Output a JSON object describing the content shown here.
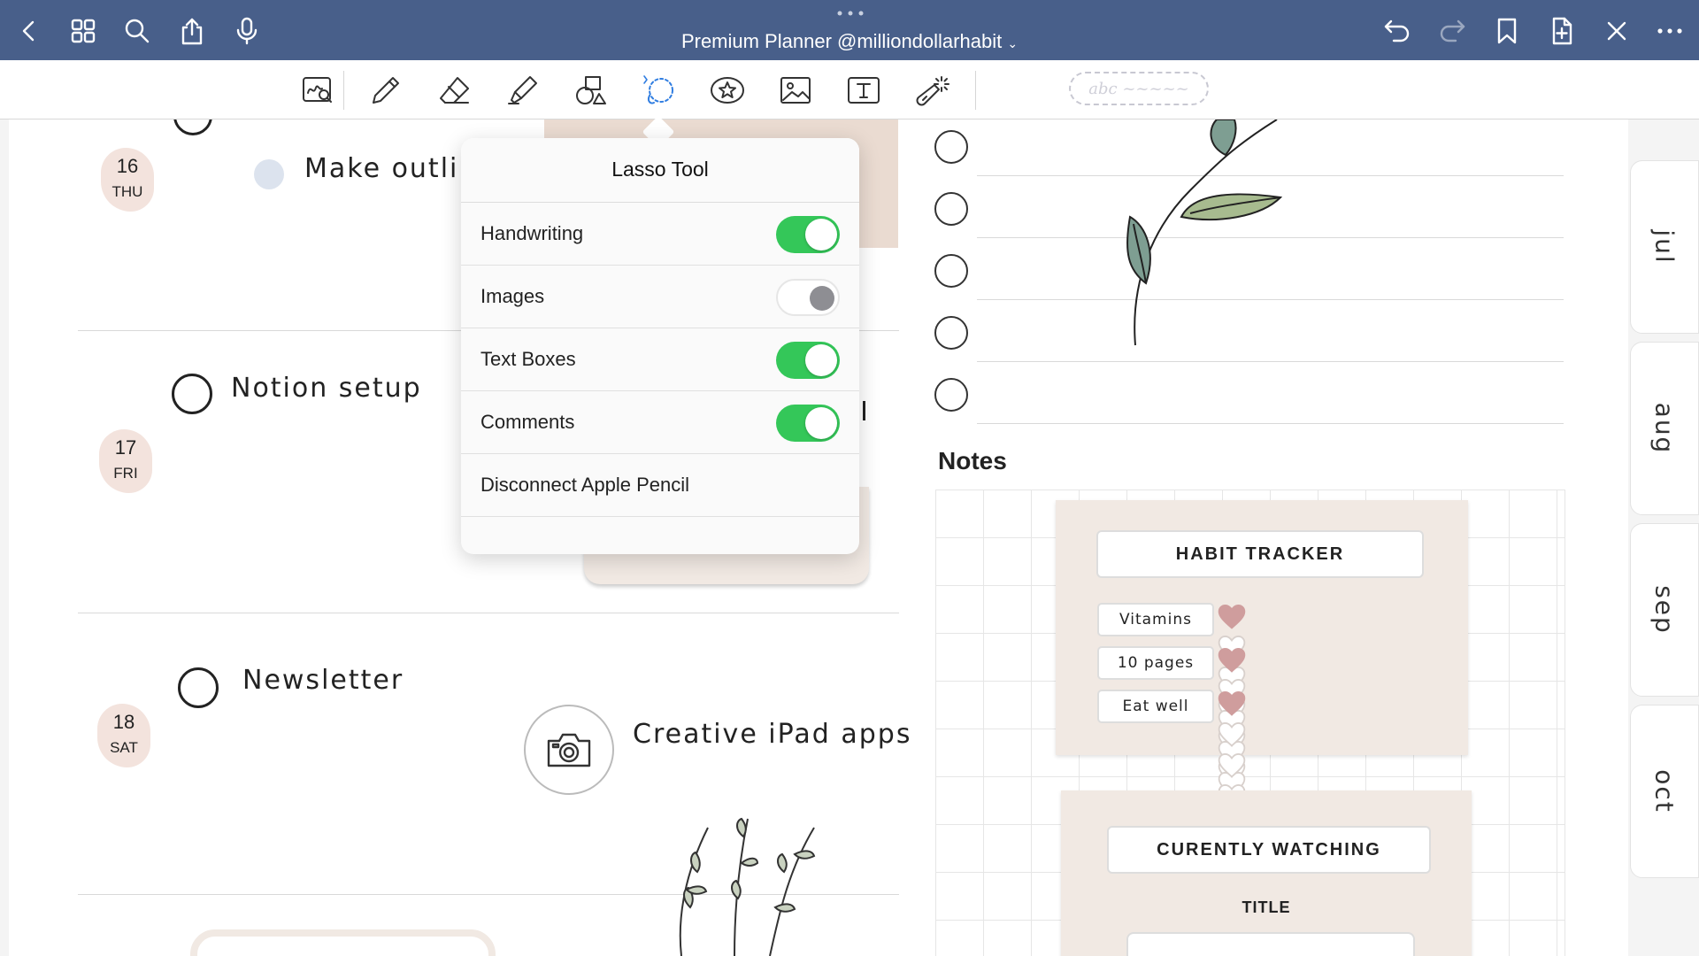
{
  "app": {
    "document_title": "Premium Planner @milliondollarhabit"
  },
  "titlebar": {
    "left_icons": [
      "back-chevron-icon",
      "grid-icon",
      "search-icon",
      "share-icon",
      "microphone-icon"
    ],
    "right_icons": [
      "undo-icon",
      "redo-icon",
      "bookmark-icon",
      "add-page-icon",
      "close-x-icon",
      "more-icon"
    ]
  },
  "toolbar": {
    "tools": [
      "handwriting-search-icon",
      "pen-icon",
      "eraser-icon",
      "highlighter-icon",
      "shapes-icon",
      "lasso-icon",
      "sticker-icon",
      "image-icon",
      "text-icon",
      "laser-pointer-icon"
    ],
    "favorites_placeholder": "abc ~~~~~"
  },
  "planner": {
    "days": [
      {
        "date": "16",
        "weekday": "THU",
        "task": "Make outli"
      },
      {
        "date": "17",
        "weekday": "FRI",
        "task": "Notion setup"
      },
      {
        "date": "18",
        "weekday": "SAT",
        "task": "Newsletter"
      }
    ],
    "sticker_caption": "Creative iPad apps"
  },
  "notes": {
    "heading": "Notes",
    "habit_tracker": {
      "title": "HABIT TRACKER",
      "habits": [
        {
          "label": "Vitamins",
          "filled": 1,
          "total": 7
        },
        {
          "label": "10 pages",
          "filled": 1,
          "total": 7
        },
        {
          "label": "Eat well",
          "filled": 1,
          "total": 7
        }
      ]
    },
    "watching": {
      "title": "CURENTLY WATCHING",
      "column": "TITLE"
    }
  },
  "side_tabs": [
    "jul",
    "aug",
    "sep",
    "oct"
  ],
  "lasso_popover": {
    "title": "Lasso Tool",
    "options": [
      {
        "label": "Handwriting",
        "on": true
      },
      {
        "label": "Images",
        "on": false
      },
      {
        "label": "Text Boxes",
        "on": true
      },
      {
        "label": "Comments",
        "on": true
      }
    ],
    "action": "Disconnect Apple Pencil"
  },
  "colors": {
    "titlebar": "#485f8a",
    "toggle_on": "#34c759",
    "heart_filled": "#cf9d9d",
    "card_bg": "#f1e9e3",
    "day_badge": "#f3e3dd"
  }
}
